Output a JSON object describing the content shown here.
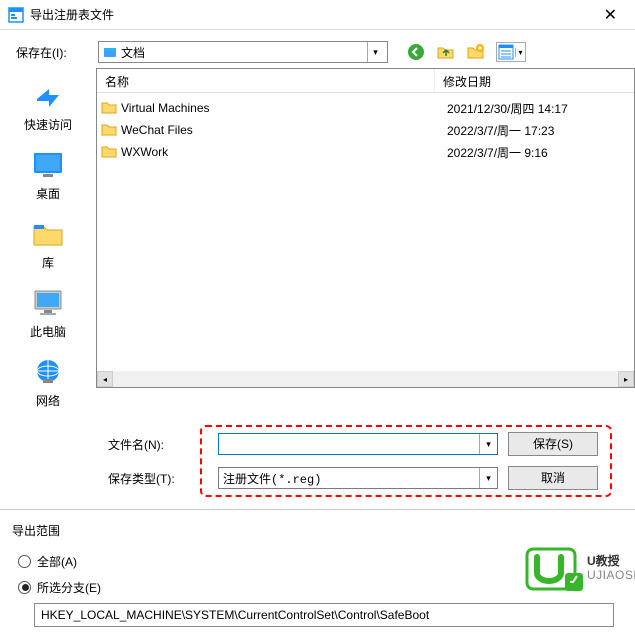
{
  "title": "导出注册表文件",
  "savein": {
    "label": "保存在(I):",
    "value": "文档",
    "columns": {
      "name": "名称",
      "date": "修改日期"
    }
  },
  "sidebar": [
    {
      "label": "快速访问"
    },
    {
      "label": "桌面"
    },
    {
      "label": "库"
    },
    {
      "label": "此电脑"
    },
    {
      "label": "网络"
    }
  ],
  "files": [
    {
      "name": "Virtual Machines",
      "date": "2021/12/30/周四 14:17"
    },
    {
      "name": "WeChat Files",
      "date": "2022/3/7/周一 17:23"
    },
    {
      "name": "WXWork",
      "date": "2022/3/7/周一 9:16"
    }
  ],
  "filename": {
    "label": "文件名(N):",
    "value": ""
  },
  "filetype": {
    "label": "保存类型(T):",
    "value": "注册文件(*.reg)"
  },
  "actions": {
    "save": "保存(S)",
    "cancel": "取消"
  },
  "scope": {
    "legend": "导出范围",
    "all": "全部(A)",
    "branch": "所选分支(E)",
    "path": "HKEY_LOCAL_MACHINE\\SYSTEM\\CurrentControlSet\\Control\\SafeBoot"
  },
  "watermark": {
    "brand": "U教授",
    "domain": "UJIAOSHOU.COM"
  }
}
